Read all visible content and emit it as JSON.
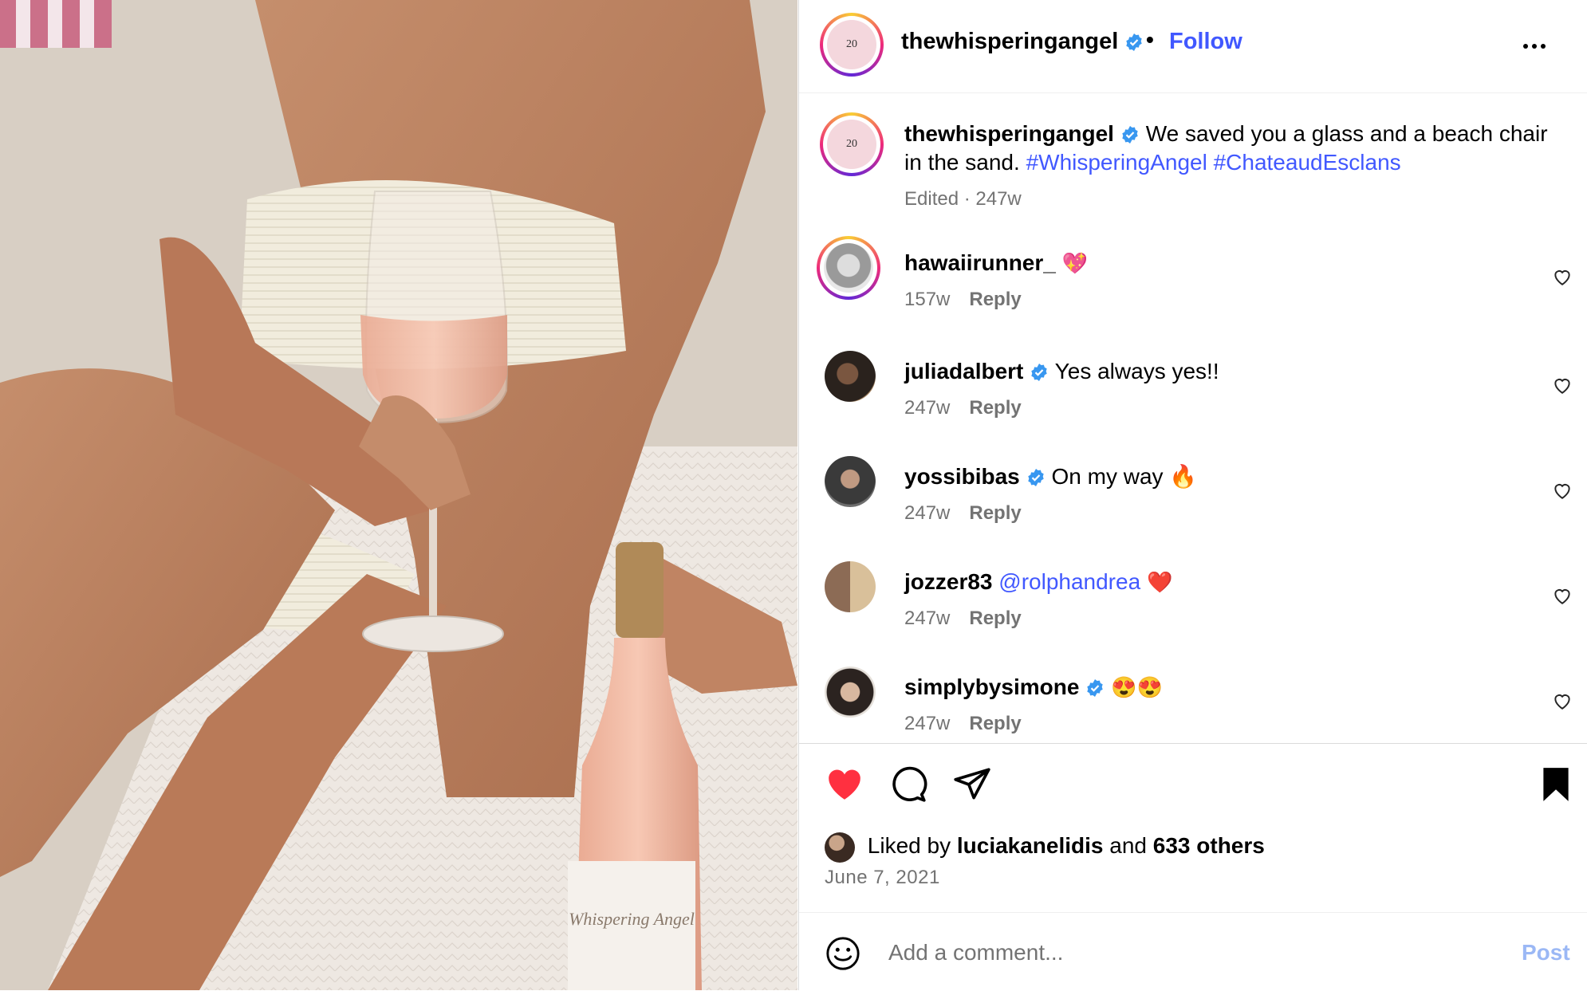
{
  "header": {
    "username": "thewhisperingangel",
    "separator": "•",
    "follow_label": "Follow",
    "avatar_text": "20"
  },
  "caption": {
    "username": "thewhisperingangel",
    "text": "We saved you a glass and a beach chair in the sand.",
    "hashtags": [
      "#WhisperingAngel",
      "#ChateaudEsclans"
    ],
    "meta": "Edited · 247w"
  },
  "comments": [
    {
      "username": "hawaiirunner_",
      "verified": false,
      "text": "💖",
      "mention": "",
      "time": "157w",
      "reply": "Reply",
      "avatar_style": "ring"
    },
    {
      "username": "juliadalbert",
      "verified": true,
      "text": "Yes always yes!!",
      "mention": "",
      "time": "247w",
      "reply": "Reply"
    },
    {
      "username": "yossibibas",
      "verified": true,
      "text": "On my way 🔥",
      "mention": "",
      "time": "247w",
      "reply": "Reply"
    },
    {
      "username": "jozzer83",
      "verified": false,
      "text": "❤️",
      "mention": "@rolphandrea",
      "time": "247w",
      "reply": "Reply"
    },
    {
      "username": "simplybysimone",
      "verified": true,
      "text": "😍😍",
      "mention": "",
      "time": "247w",
      "reply": "Reply"
    }
  ],
  "likes": {
    "prefix": "Liked by",
    "user": "luciakanelidis",
    "middle": "and",
    "others": "633 others"
  },
  "post_date": "June 7, 2021",
  "comment_box": {
    "placeholder": "Add a comment...",
    "post_label": "Post"
  },
  "colors": {
    "accent": "#4158ff",
    "like_red": "#ff3040",
    "verified_blue": "#3897f0",
    "muted": "#737373",
    "post_disabled": "#9bb8f5"
  },
  "icons": {
    "like": "heart-filled-icon",
    "comment": "comment-bubble-icon",
    "share": "paper-plane-icon",
    "save": "bookmark-filled-icon",
    "more": "more-horizontal-icon",
    "emoji": "smiley-icon",
    "comment_like": "heart-outline-icon",
    "verified": "verified-badge-icon"
  },
  "photo": {
    "bottle_label": "Whispering Angel"
  }
}
